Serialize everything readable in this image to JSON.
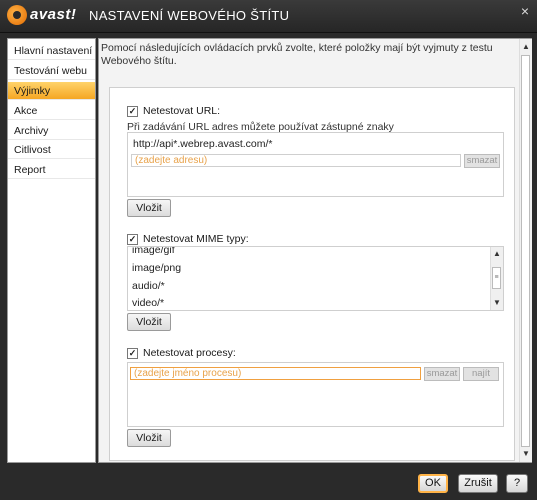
{
  "window": {
    "logo_text": "avast!",
    "title": "NASTAVENÍ WEBOVÉHO ŠTÍTU",
    "close_glyph": "×"
  },
  "sidebar": {
    "items": [
      {
        "label": "Hlavní nastavení"
      },
      {
        "label": "Testování webu"
      },
      {
        "label": "Výjimky",
        "active": true
      },
      {
        "label": "Akce"
      },
      {
        "label": "Archivy"
      },
      {
        "label": "Citlivost"
      },
      {
        "label": "Report"
      }
    ]
  },
  "content": {
    "description": "Pomocí následujících ovládacích prvků zvolte, které položky mají být vyjmuty z testu Webového štítu."
  },
  "url_section": {
    "checkbox_label": "Netestovat URL:",
    "checked": true,
    "note": "Při zadávání URL adres můžete používat zástupné znaky",
    "entries": [
      "http://api*.webrep.avast.com/*"
    ],
    "input_placeholder": "(zadejte adresu)",
    "delete_label": "smazat",
    "insert_label": "Vložit"
  },
  "mime_section": {
    "checkbox_label": "Netestovat MIME typy:",
    "checked": true,
    "entries": [
      "image/gif",
      "image/png",
      "audio/*",
      "video/*"
    ],
    "insert_label": "Vložit"
  },
  "process_section": {
    "checkbox_label": "Netestovat procesy:",
    "checked": true,
    "input_placeholder": "(zadejte jméno procesu)",
    "delete_label": "smazat",
    "find_label": "najít",
    "insert_label": "Vložit"
  },
  "footer": {
    "ok_label": "OK",
    "cancel_label": "Zrušit",
    "help_label": "?"
  },
  "colors": {
    "accent": "#f5a623",
    "titlebar": "#2a2a2a",
    "placeholder_text": "#e8a24a"
  },
  "icons": {
    "checkbox_check": "check-icon",
    "scroll_up": "arrow-up-icon",
    "scroll_down": "arrow-down-icon",
    "close": "close-icon"
  }
}
